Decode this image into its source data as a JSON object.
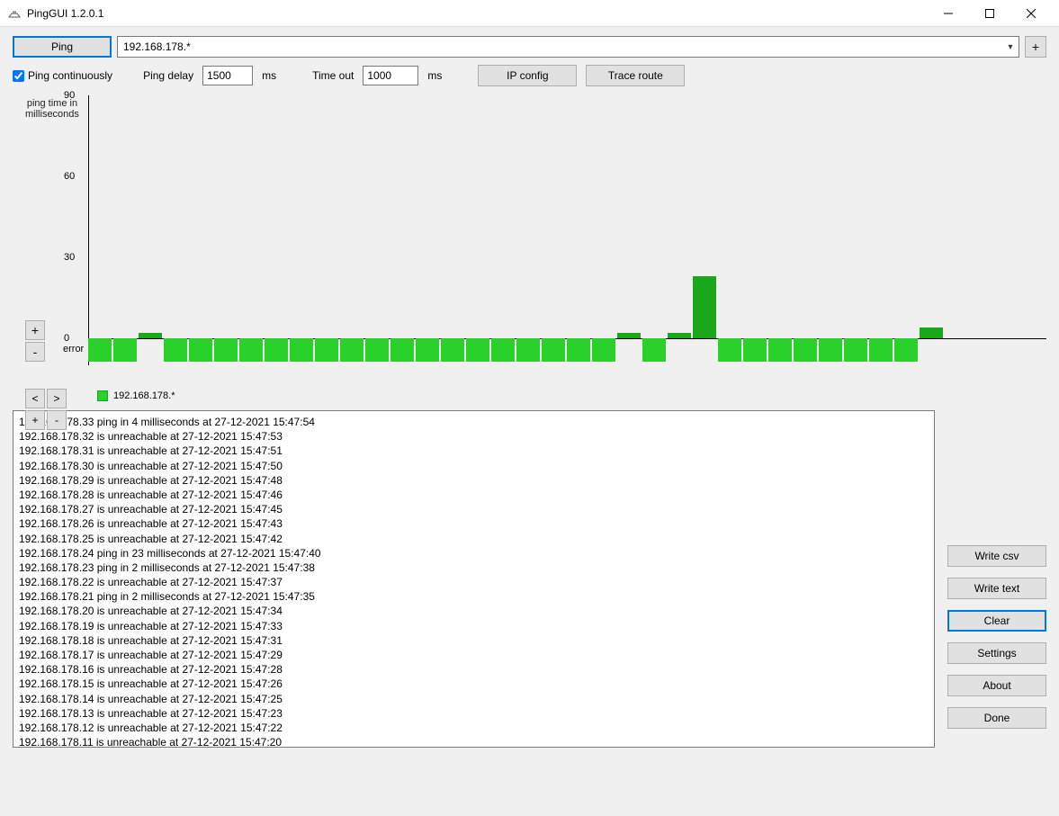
{
  "app": {
    "title": "PingGUI 1.2.0.1"
  },
  "toolbar": {
    "ping_label": "Ping",
    "address_value": "192.168.178.*",
    "add_label": "+"
  },
  "options": {
    "continuous_label": "Ping continuously",
    "continuous_checked": true,
    "ping_delay_label": "Ping delay",
    "ping_delay_value": "1500",
    "ms1": "ms",
    "timeout_label": "Time out",
    "timeout_value": "1000",
    "ms2": "ms",
    "ipconfig_label": "IP config",
    "traceroute_label": "Trace route"
  },
  "chart_data": {
    "type": "bar",
    "ylabel": "ping time in\nmilliseconds",
    "ylim": [
      0,
      90
    ],
    "yticks": [
      0,
      30,
      60,
      90
    ],
    "error_label": "error",
    "legend": "192.168.178.*",
    "baseline_y": 0,
    "bars": [
      {
        "v": -12
      },
      {
        "v": -12
      },
      {
        "v": 2
      },
      {
        "v": -12
      },
      {
        "v": -12
      },
      {
        "v": -12
      },
      {
        "v": -12
      },
      {
        "v": -12
      },
      {
        "v": -12
      },
      {
        "v": -12
      },
      {
        "v": -12
      },
      {
        "v": -12
      },
      {
        "v": -12
      },
      {
        "v": -12
      },
      {
        "v": -12
      },
      {
        "v": -12
      },
      {
        "v": -12
      },
      {
        "v": -12
      },
      {
        "v": -12
      },
      {
        "v": -12
      },
      {
        "v": -12
      },
      {
        "v": 2
      },
      {
        "v": -12
      },
      {
        "v": 2
      },
      {
        "v": 23
      },
      {
        "v": -12
      },
      {
        "v": -12
      },
      {
        "v": -12
      },
      {
        "v": -12
      },
      {
        "v": -12
      },
      {
        "v": -12
      },
      {
        "v": -12
      },
      {
        "v": -12
      },
      {
        "v": 4
      }
    ]
  },
  "zoom": {
    "plus": "+",
    "minus": "-",
    "left": "<",
    "right": ">"
  },
  "log_lines": [
    "192.168.178.33 ping in 4 milliseconds at 27-12-2021 15:47:54",
    "192.168.178.32 is unreachable at 27-12-2021 15:47:53",
    "192.168.178.31 is unreachable at 27-12-2021 15:47:51",
    "192.168.178.30 is unreachable at 27-12-2021 15:47:50",
    "192.168.178.29 is unreachable at 27-12-2021 15:47:48",
    "192.168.178.28 is unreachable at 27-12-2021 15:47:46",
    "192.168.178.27 is unreachable at 27-12-2021 15:47:45",
    "192.168.178.26 is unreachable at 27-12-2021 15:47:43",
    "192.168.178.25 is unreachable at 27-12-2021 15:47:42",
    "192.168.178.24 ping in 23 milliseconds at 27-12-2021 15:47:40",
    "192.168.178.23 ping in 2 milliseconds at 27-12-2021 15:47:38",
    "192.168.178.22 is unreachable at 27-12-2021 15:47:37",
    "192.168.178.21 ping in 2 milliseconds at 27-12-2021 15:47:35",
    "192.168.178.20 is unreachable at 27-12-2021 15:47:34",
    "192.168.178.19 is unreachable at 27-12-2021 15:47:33",
    "192.168.178.18 is unreachable at 27-12-2021 15:47:31",
    "192.168.178.17 is unreachable at 27-12-2021 15:47:29",
    "192.168.178.16 is unreachable at 27-12-2021 15:47:28",
    "192.168.178.15 is unreachable at 27-12-2021 15:47:26",
    "192.168.178.14 is unreachable at 27-12-2021 15:47:25",
    "192.168.178.13 is unreachable at 27-12-2021 15:47:23",
    "192.168.178.12 is unreachable at 27-12-2021 15:47:22",
    "192.168.178.11 is unreachable at 27-12-2021 15:47:20"
  ],
  "side": {
    "write_csv": "Write csv",
    "write_text": "Write text",
    "clear": "Clear",
    "settings": "Settings",
    "about": "About",
    "done": "Done"
  }
}
